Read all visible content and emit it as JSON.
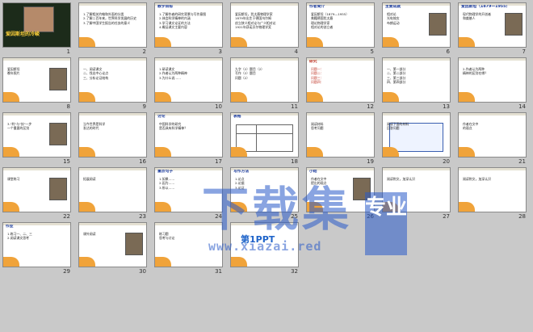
{
  "slides": [
    {
      "n": "1",
      "style": "dark",
      "lines": [],
      "title": "爱因斯坦的冷峻"
    },
    {
      "n": "2",
      "style": "list",
      "hd": "",
      "lines": [
        "1.了解相关约翰和外面的分类",
        "2.了解二百年来，世界科学发展的历史",
        "3.了解中国学生报告的任务的意义"
      ]
    },
    {
      "n": "3",
      "style": "text",
      "hd": "教学目标",
      "lines": [
        "1.了解作者的研究背景与写作意图",
        "2.体会科学精神的内涵",
        "3.学习课文论证的方法",
        "4.概括课文主要内容"
      ]
    },
    {
      "n": "4",
      "style": "text",
      "hd": "",
      "lines": [
        "爱因斯坦，犹太裔物理学家",
        "1879年出生于德国乌尔姆",
        "创立狭义相对论与广义相对论",
        "1921年获诺贝尔物理学奖"
      ]
    },
    {
      "n": "5",
      "style": "text",
      "hd": "作者简介",
      "lines": [
        "爱因斯坦（1879—1955）",
        "美籍德国犹太裔",
        "理论物理学家",
        "相对论的创立者"
      ]
    },
    {
      "n": "6",
      "style": "photo",
      "hd": "主要成就",
      "lines": [
        "相对论",
        "光电效应",
        "布朗运动"
      ]
    },
    {
      "n": "7",
      "style": "photo",
      "hd": "爱因斯坦（1879—1955）",
      "lines": [
        "现代物理学的开创者",
        "和奠基人"
      ]
    },
    {
      "n": "8",
      "style": "photo",
      "hd": "",
      "lines": [
        "爱因斯坦",
        "晚年照片"
      ]
    },
    {
      "n": "9",
      "style": "text",
      "hd": "",
      "lines": [
        "一、阅读课文",
        "二、找出中心论点",
        "三、分析论证结构"
      ]
    },
    {
      "n": "10",
      "style": "list",
      "hd": "",
      "lines": [
        "1.研读课文",
        "2.作者认为两种精神",
        "3.为什么说……"
      ]
    },
    {
      "n": "11",
      "style": "list",
      "hd": "",
      "lines": [
        "九字（2）题目（2）",
        "写作（2）题目",
        "问题（2）"
      ]
    },
    {
      "n": "12",
      "style": "red",
      "hd": "研究",
      "lines": [
        "问题一：",
        "问题二：",
        "问题三：",
        "问题四："
      ]
    },
    {
      "n": "13",
      "style": "text",
      "hd": "",
      "lines": [
        "一、第一部分",
        "二、第二部分",
        "三、第三部分",
        "四、第四部分"
      ]
    },
    {
      "n": "14",
      "style": "text",
      "hd": "",
      "lines": [
        "2.作者认为两种",
        "精神的区别在哪？"
      ]
    },
    {
      "n": "15",
      "style": "photo",
      "hd": "",
      "lines": [
        "3.\"利\"与\"技\"一步",
        "一个重要的区别"
      ]
    },
    {
      "n": "16",
      "style": "text",
      "hd": "",
      "lines": [
        "当今世界是科学",
        "发达的时代"
      ]
    },
    {
      "n": "17",
      "style": "text",
      "hd": "讨论",
      "lines": [
        "中国科学的研究",
        "是否具有科学精神？"
      ]
    },
    {
      "n": "18",
      "style": "table",
      "hd": "表格",
      "lines": []
    },
    {
      "n": "19",
      "style": "text",
      "hd": "",
      "lines": [
        "阅读材料",
        "思考问题"
      ]
    },
    {
      "n": "20",
      "style": "boxed",
      "hd": "",
      "lines": [
        "阅读下面的材料",
        "回答问题"
      ]
    },
    {
      "n": "21",
      "style": "text",
      "hd": "",
      "lines": [
        "作者在文中",
        "的观点"
      ]
    },
    {
      "n": "22",
      "style": "photo",
      "hd": "",
      "lines": [
        "课堂练习"
      ]
    },
    {
      "n": "23",
      "style": "text",
      "hd": "",
      "lines": [
        "拓展阅读"
      ]
    },
    {
      "n": "24",
      "style": "text",
      "hd": "重点句子",
      "lines": [
        "1.如果……",
        "2.因为……",
        "3.所以……"
      ]
    },
    {
      "n": "25",
      "style": "text",
      "hd": "写作方法",
      "lines": [
        "1.论点",
        "2.论据",
        "3.论证"
      ]
    },
    {
      "n": "26",
      "style": "photo",
      "hd": "小结",
      "lines": [
        "作者在文中",
        "提出的观点"
      ]
    },
    {
      "n": "27",
      "style": "text",
      "hd": "",
      "lines": [
        "阅读附文，加深认识"
      ]
    },
    {
      "n": "28",
      "style": "text",
      "hd": "",
      "lines": [
        "阅读附文，加深认识"
      ]
    },
    {
      "n": "29",
      "style": "text",
      "hd": "作业",
      "lines": [
        "1.练习一、二、三",
        "2.阅读课文思考"
      ]
    },
    {
      "n": "30",
      "style": "photo",
      "hd": "",
      "lines": [
        "课外阅读"
      ]
    },
    {
      "n": "31",
      "style": "text",
      "hd": "",
      "lines": [
        "练习题",
        "思考与讨论"
      ]
    },
    {
      "n": "32",
      "style": "ppt",
      "hd": "",
      "lines": [],
      "logo": "第1PPT"
    }
  ],
  "watermark": {
    "text": "下载集",
    "badge": "专业",
    "url": "www.xiazai.red"
  }
}
